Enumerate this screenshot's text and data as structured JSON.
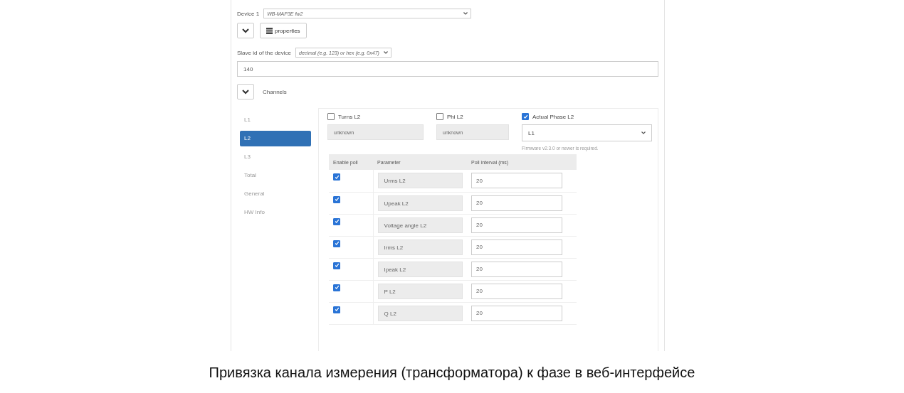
{
  "device": {
    "label": "Device 1",
    "value": "WB-MAP3E fw2"
  },
  "properties_button": {
    "label": "properties"
  },
  "slave_id": {
    "label": "Slave id of the device",
    "format": "decimal (e.g. 123) or hex (e.g. 0x47)",
    "value": "140"
  },
  "channels": {
    "label": "Channels",
    "tabs": [
      {
        "label": "L1",
        "selected": false
      },
      {
        "label": "L2",
        "selected": true
      },
      {
        "label": "L3",
        "selected": false
      },
      {
        "label": "Total",
        "selected": false
      },
      {
        "label": "General",
        "selected": false
      },
      {
        "label": "HW Info",
        "selected": false
      }
    ],
    "settings": [
      {
        "label": "Turns L2",
        "checked": false,
        "kind": "text",
        "value": "unknown"
      },
      {
        "label": "Phi L2",
        "checked": false,
        "kind": "text",
        "value": "unknown"
      },
      {
        "label": "Actual Phase L2",
        "checked": true,
        "kind": "select",
        "value": "L1",
        "hint": "Firmware v2.3.0 or newer is required."
      }
    ],
    "table": {
      "columns": [
        "Enable poll",
        "Parameter",
        "Poll interval (ms)"
      ],
      "rows": [
        {
          "enabled": true,
          "parameter": "Urms L2",
          "interval": "20"
        },
        {
          "enabled": true,
          "parameter": "Upeak L2",
          "interval": "20"
        },
        {
          "enabled": true,
          "parameter": "Voltage angle L2",
          "interval": "20"
        },
        {
          "enabled": true,
          "parameter": "Irms L2",
          "interval": "20"
        },
        {
          "enabled": true,
          "parameter": "Ipeak L2",
          "interval": "20"
        },
        {
          "enabled": true,
          "parameter": "P L2",
          "interval": "20"
        },
        {
          "enabled": true,
          "parameter": "Q L2",
          "interval": "20"
        }
      ]
    }
  },
  "caption": "Привязка канала измерения (трансформатора) к фазе в веб-интерфейсе"
}
